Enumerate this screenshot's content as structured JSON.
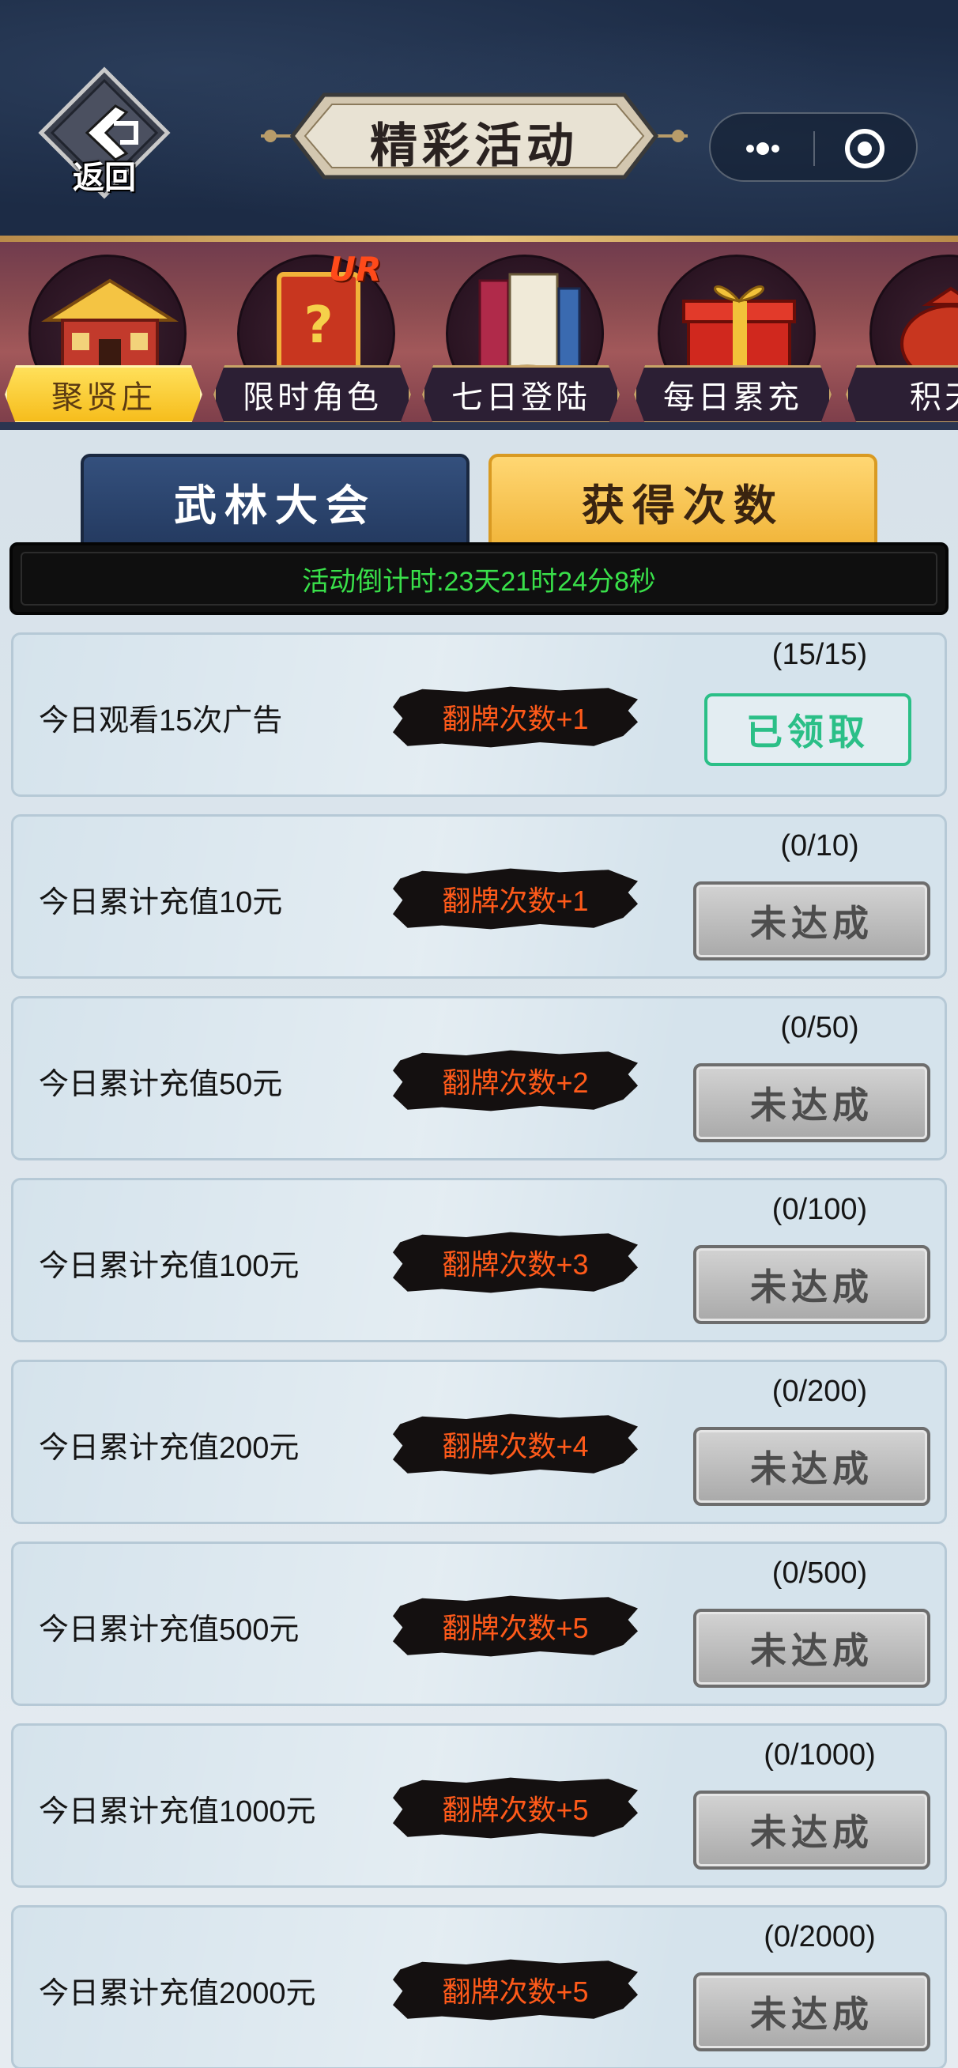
{
  "header": {
    "back_label": "返回",
    "title": "精彩活动"
  },
  "activities": [
    {
      "label": "聚贤庄",
      "icon": "pavilion-icon",
      "active": true
    },
    {
      "label": "限时角色",
      "icon": "mystery-card-icon",
      "badge": "UR"
    },
    {
      "label": "七日登陆",
      "icon": "scroll-books-icon"
    },
    {
      "label": "每日累充",
      "icon": "gift-box-icon"
    },
    {
      "label": "积天",
      "icon": "money-bag-icon"
    }
  ],
  "tabs": [
    {
      "label": "武林大会"
    },
    {
      "label": "获得次数"
    }
  ],
  "countdown": "活动倒计时:23天21时24分8秒",
  "tasks": [
    {
      "desc": "今日观看15次广告",
      "reward": "翻牌次数+1",
      "progress": "(15/15)",
      "status": "已领取"
    },
    {
      "desc": "今日累计充值10元",
      "reward": "翻牌次数+1",
      "progress": "(0/10)",
      "status": "未达成"
    },
    {
      "desc": "今日累计充值50元",
      "reward": "翻牌次数+2",
      "progress": "(0/50)",
      "status": "未达成"
    },
    {
      "desc": "今日累计充值100元",
      "reward": "翻牌次数+3",
      "progress": "(0/100)",
      "status": "未达成"
    },
    {
      "desc": "今日累计充值200元",
      "reward": "翻牌次数+4",
      "progress": "(0/200)",
      "status": "未达成"
    },
    {
      "desc": "今日累计充值500元",
      "reward": "翻牌次数+5",
      "progress": "(0/500)",
      "status": "未达成"
    },
    {
      "desc": "今日累计充值1000元",
      "reward": "翻牌次数+5",
      "progress": "(0/1000)",
      "status": "未达成"
    },
    {
      "desc": "今日累计充值2000元",
      "reward": "翻牌次数+5",
      "progress": "(0/2000)",
      "status": "未达成"
    }
  ],
  "colors": {
    "header_bg": "#1c2b45",
    "countdown_text": "#39e04a",
    "reward_text": "#ff5a1a",
    "claimed": "#2bbf87",
    "active_tab": "#f1b53a"
  }
}
